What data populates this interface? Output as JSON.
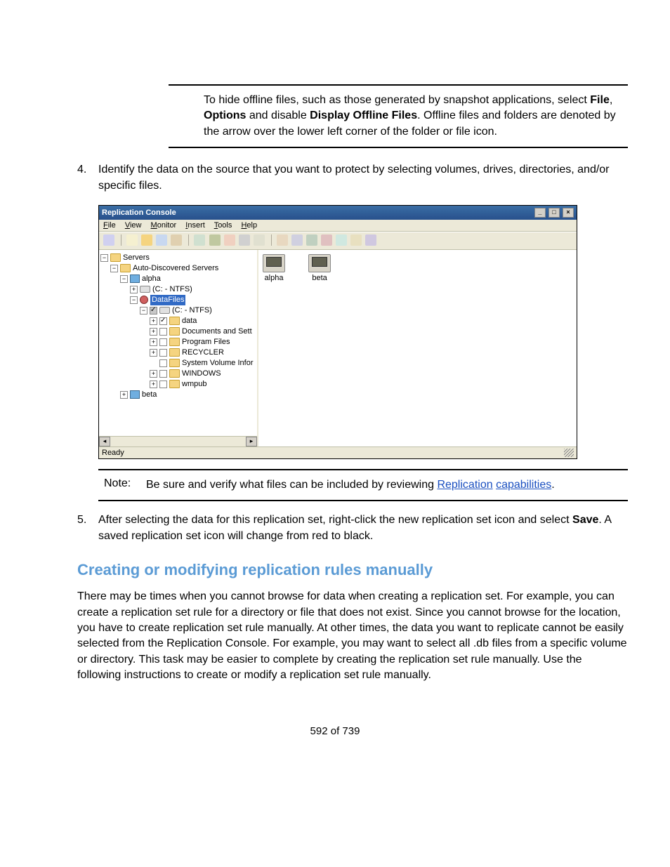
{
  "callout": {
    "pre": "To hide offline files, such as those generated by snapshot applications, select ",
    "b1": "File",
    "sep1": ", ",
    "b2": "Options",
    "mid": " and disable ",
    "b3": "Display Offline Files",
    "post": ". Offline files and folders are denoted by the arrow over the lower left corner of the folder or file icon."
  },
  "step4": {
    "num": "4.",
    "text": "Identify the data on the source that you want to protect by selecting volumes, drives, directories, and/or specific files."
  },
  "screenshot": {
    "title": "Replication Console",
    "menus": [
      "File",
      "View",
      "Monitor",
      "Insert",
      "Tools",
      "Help"
    ],
    "status": "Ready",
    "main_servers": [
      "alpha",
      "beta"
    ],
    "tree": {
      "n0": "Servers",
      "n1": "Auto-Discovered Servers",
      "n2": "alpha",
      "n3": "(C: - NTFS)",
      "n4": "DataFiles",
      "n5": "(C: - NTFS)",
      "n6": "data",
      "n7": "Documents and Sett",
      "n8": "Program Files",
      "n9": "RECYCLER",
      "n10": "System Volume Infor",
      "n11": "WINDOWS",
      "n12": "wmpub",
      "n13": "beta"
    }
  },
  "note": {
    "label": "Note:",
    "pre": "Be sure and verify what files can be included by reviewing ",
    "linkA": "Replication",
    "linkB": "capabilities",
    "post": "."
  },
  "step5": {
    "num": "5.",
    "pre": "After selecting the data for this replication set, right-click the new replication set icon and select ",
    "b1": "Save",
    "post": ". A saved replication set icon will change from red to black."
  },
  "section_heading": "Creating or modifying replication rules manually",
  "para1": "There may be times when you cannot browse for data when creating a replication set. For example, you can create a replication set rule for a directory or file that does not exist. Since you cannot browse for the location, you have to create replication set rule manually. At other times, the data you want to replicate cannot be easily selected from the Replication Console. For example, you may want to select all .db files from a specific volume or directory. This task may be easier to complete by creating the replication set rule manually. Use the following instructions to create or modify a replication set rule manually.",
  "footer": "592 of 739"
}
